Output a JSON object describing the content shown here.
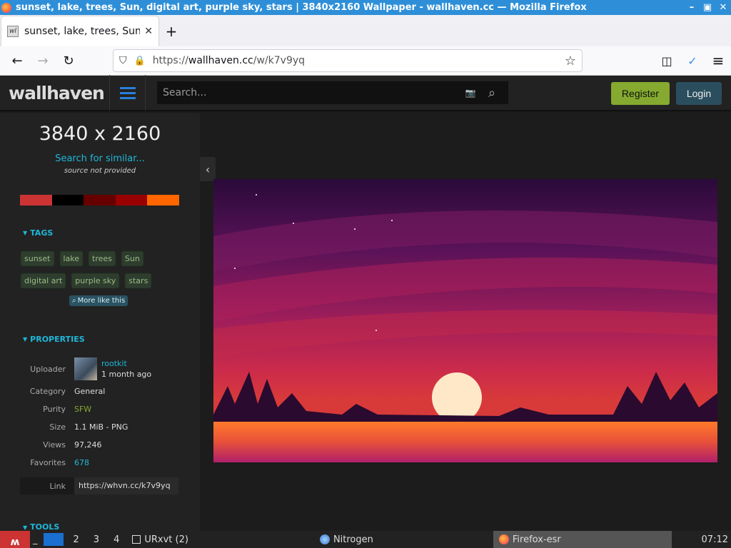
{
  "window": {
    "title": "sunset, lake, trees, Sun, digital art, purple sky, stars | 3840x2160 Wallpaper - wallhaven.cc — Mozilla Firefox",
    "minimize": "–",
    "maximize": "▣",
    "close": "✕"
  },
  "tab": {
    "favicon_text": "wl",
    "label": "sunset, lake, trees, Sun, digital art, purple sky, stars",
    "close": "✕",
    "new_tab": "+"
  },
  "nav": {
    "back": "←",
    "forward": "→",
    "reload": "↻",
    "url_prefix": "https://",
    "url_domain": "wallhaven.cc",
    "url_path": "/w/k7v9yq",
    "star": "☆",
    "pocket": "◫",
    "account": "✓",
    "menu": "≡"
  },
  "site": {
    "logo": "wallhaven",
    "search_placeholder": "Search...",
    "camera_icon": "📷",
    "search_icon": "⌕",
    "register": "Register",
    "login": "Login"
  },
  "sidebar": {
    "resolution": "3840 x 2160",
    "similar": "Search for similar...",
    "source": "source not provided",
    "palette": [
      "#cc3333",
      "#000000",
      "#660000",
      "#990000",
      "#ff6600"
    ],
    "tags_header": "TAGS",
    "tags": [
      "sunset",
      "lake",
      "trees",
      "Sun",
      "digital art",
      "purple sky",
      "stars"
    ],
    "more_like": "More like this",
    "properties_header": "PROPERTIES",
    "uploader_label": "Uploader",
    "uploader_name": "rootkit",
    "uploader_time": "1 month ago",
    "category_label": "Category",
    "category": "General",
    "purity_label": "Purity",
    "purity": "SFW",
    "size_label": "Size",
    "size": "1.1 MiB - PNG",
    "views_label": "Views",
    "views": "97,246",
    "favorites_label": "Favorites",
    "favorites": "678",
    "link_label": "Link",
    "link": "https://whvn.cc/k7v9yq",
    "tools_header": "TOOLS",
    "caret": "▼"
  },
  "main": {
    "collapse": "‹"
  },
  "taskbar": {
    "logo": "ʍ",
    "ws_sep": "_",
    "ws2": "2",
    "ws3": "3",
    "ws4": "4",
    "urxvt": "URxvt (2)",
    "nitrogen": "Nitrogen",
    "firefox": "Firefox-esr",
    "clock": "07:12"
  }
}
